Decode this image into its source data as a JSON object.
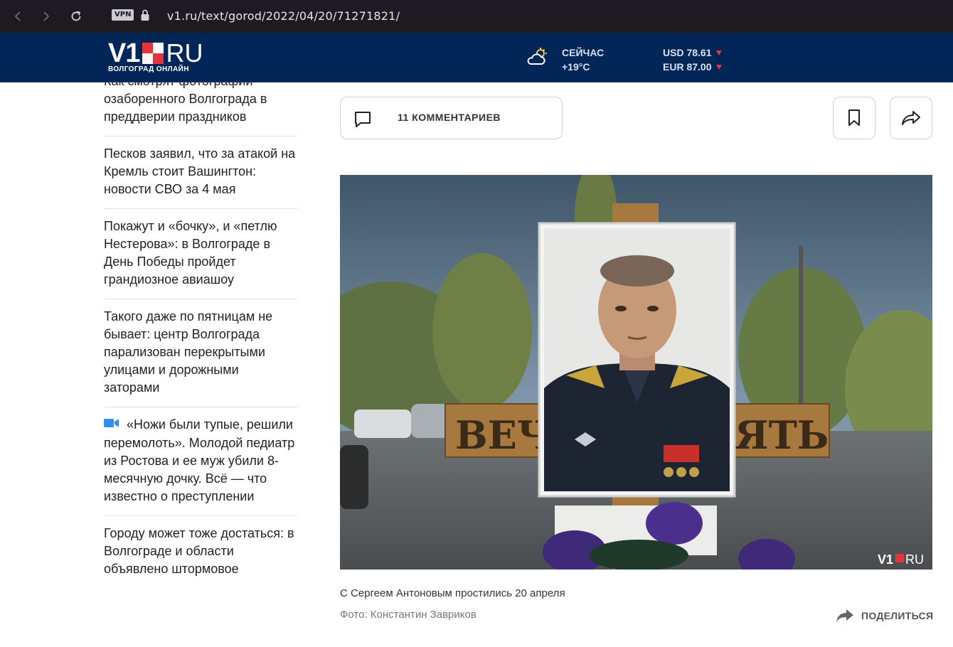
{
  "browser": {
    "vpn_label": "VPN",
    "url_host": "v1.ru",
    "url_path": "/text/gorod/2022/04/20/71271821/"
  },
  "header": {
    "logo_v1": "V1",
    "logo_ru": "RU",
    "logo_subtitle": "ВОЛГОГРАД ОНЛАЙН",
    "weather_label": "СЕЙЧАС",
    "weather_temp": "+19°C",
    "usd": "USD 78.61",
    "eur": "EUR 87.00",
    "colors": {
      "header_bg": "#032659",
      "logo_red": "#e5333f",
      "down": "#e5333f"
    }
  },
  "sidebar": {
    "items": [
      {
        "text": "Как смотрят фотографии озаборенного Волгограда в преддверии праздников",
        "video": false
      },
      {
        "text": "Песков заявил, что за атакой на Кремль стоит Вашингтон: новости СВО за 4 мая",
        "video": false
      },
      {
        "text": "Покажут и «бочку», и «петлю Нестерова»: в Волгограде в День Победы пройдет грандиозное авиашоу",
        "video": false
      },
      {
        "text": "Такого даже по пятницам не бывает: центр Волгограда парализован перекрытыми улицами и дорожными заторами",
        "video": false
      },
      {
        "text": "«Ножи были тупые, решили перемолоть». Молодой педиатр из Ростова и ее муж убили 8-месячную дочку. Всё — что известно о преступлении",
        "video": true
      },
      {
        "text": "Городу может тоже достаться: в Волгограде и области объявлено штормовое",
        "video": false
      }
    ]
  },
  "article": {
    "comments_label": "11 КОММЕНТАРИЕВ",
    "photo_watermark_v1": "V1",
    "photo_watermark_ru": "RU",
    "photo_sign_left": "ВЕЧН",
    "photo_sign_right": "ЯТЬ",
    "caption": "С Сергеем Антоновым простились 20 апреля",
    "credit": "Фото: Константин Завриков",
    "share_label": "ПОДЕЛИТЬСЯ"
  }
}
